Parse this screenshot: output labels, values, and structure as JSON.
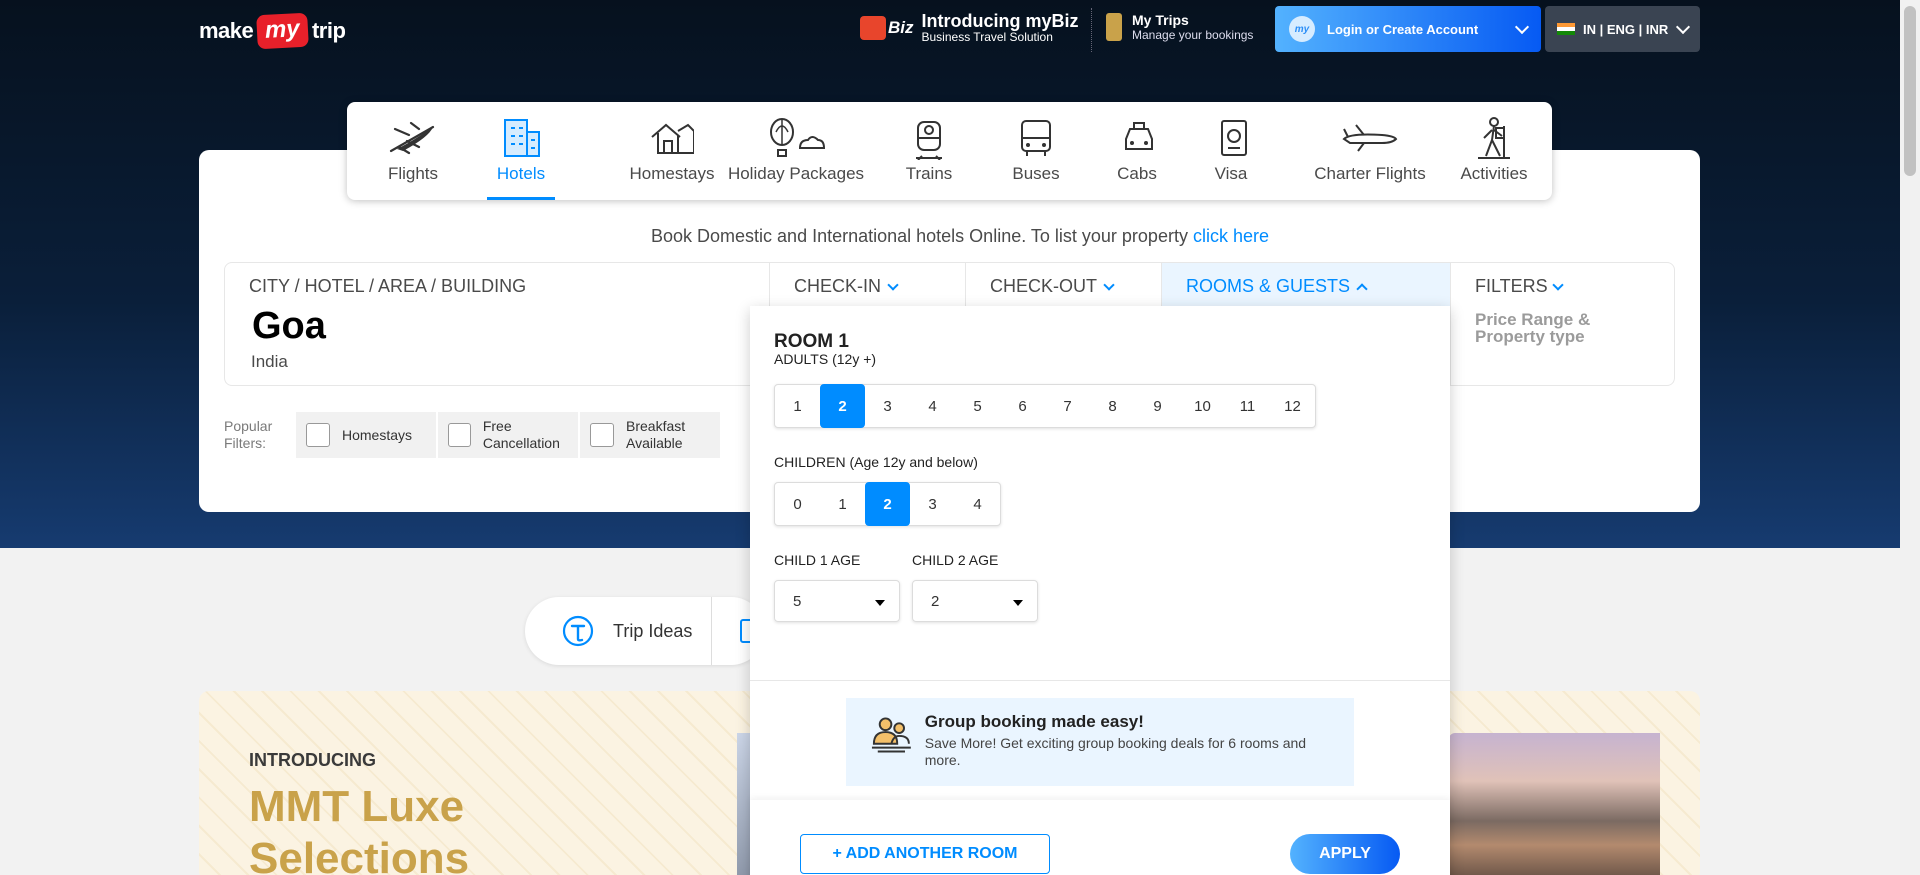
{
  "header": {
    "logo": {
      "left": "make",
      "mid": "my",
      "right": "trip"
    },
    "mybiz": {
      "badge": "Biz",
      "title": "Introducing myBiz",
      "subtitle": "Business Travel Solution"
    },
    "mytrips": {
      "title": "My Trips",
      "subtitle": "Manage your bookings"
    },
    "login": {
      "badge": "my",
      "label": "Login or Create Account"
    },
    "lang": {
      "label": "IN | ENG | INR"
    }
  },
  "nav": {
    "items": [
      {
        "label": "Flights",
        "icon": "plane-icon"
      },
      {
        "label": "Hotels",
        "icon": "hotel-icon",
        "active": true
      },
      {
        "label": "Homestays",
        "icon": "home-icon"
      },
      {
        "label": "Holiday Packages",
        "icon": "balloon-icon"
      },
      {
        "label": "Trains",
        "icon": "train-icon"
      },
      {
        "label": "Buses",
        "icon": "bus-icon"
      },
      {
        "label": "Cabs",
        "icon": "cab-icon"
      },
      {
        "label": "Visa",
        "icon": "passport-icon"
      },
      {
        "label": "Charter Flights",
        "icon": "jet-icon"
      },
      {
        "label": "Activities",
        "icon": "hiker-icon"
      }
    ]
  },
  "tagline": {
    "text": "Book Domestic and International hotels Online. To list your property",
    "link": "click here"
  },
  "search": {
    "city_label": "CITY / HOTEL / AREA / BUILDING",
    "city_value": "Goa",
    "city_sub": "India",
    "checkin_label": "CHECK-IN",
    "checkout_label": "CHECK-OUT",
    "rooms_label": "ROOMS & GUESTS",
    "filters_label": "FILTERS",
    "filters_sub": "Price Range & Property type"
  },
  "popular_filters": {
    "label": "Popular Filters:",
    "chips": [
      "Homestays",
      "Free Cancellation",
      "Breakfast Available"
    ]
  },
  "trip_ideas": {
    "label": "Trip Ideas"
  },
  "luxe": {
    "intro": "INTRODUCING",
    "title": "MMT Luxe Selections"
  },
  "dropdown": {
    "room_title": "ROOM 1",
    "adults_label": "ADULTS (12y +)",
    "adults_options": [
      "1",
      "2",
      "3",
      "4",
      "5",
      "6",
      "7",
      "8",
      "9",
      "10",
      "11",
      "12"
    ],
    "adults_selected": "2",
    "children_label": "CHILDREN (Age 12y and below)",
    "children_options": [
      "0",
      "1",
      "2",
      "3",
      "4"
    ],
    "children_selected": "2",
    "child1_label": "CHILD 1 AGE",
    "child1_value": "5",
    "child2_label": "CHILD 2 AGE",
    "child2_value": "2",
    "group_title": "Group booking made easy!",
    "group_sub": "Save More! Get exciting group booking deals for 6 rooms and more.",
    "add_room": "+ ADD ANOTHER ROOM",
    "apply": "APPLY"
  },
  "colors": {
    "accent": "#008cff",
    "brand_red": "#e8202a",
    "luxe_gold": "#c9a24a"
  }
}
